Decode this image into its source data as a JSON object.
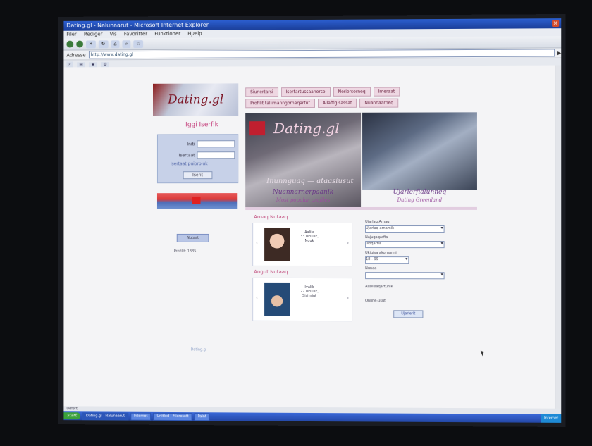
{
  "window": {
    "title": "Dating.gl - Nalunaarut - Microsoft Internet Explorer"
  },
  "address": {
    "value": "http://www.dating.gl"
  },
  "site": {
    "logo_text": "Dating.gl",
    "nav_row1": [
      "Siunertarsi",
      "Isertartussaanerso",
      "Neriorsorneq",
      "Imeraat"
    ],
    "nav_row2": [
      "Profilit tallimanngorneqartut",
      "Allaffigisassat",
      "Nuannaarneq"
    ],
    "login_title": "Iggi Iserfik",
    "login_user_label": "Initi",
    "login_pass_label": "Isertaat",
    "login_hint": "Isertaat puiorpiuk",
    "login_button": "Iserit",
    "hero1_logo": "Dating.gl",
    "hero1_sub": "Inunnguaq — ataasiusut",
    "cap1": "Nuannarnerpaanik",
    "cap1b": "Most popular profiles",
    "cap2": "Ujarlerfialunneq",
    "cap2b": "Dating Greenland",
    "section1": "Arnaq Nutaaq",
    "section2": "Angut Nutaaq",
    "profile1": {
      "name": "Aaliia",
      "info": "33 ukiulik, Nuuk"
    },
    "profile2": {
      "name": "Ivalik",
      "info": "27 ukiulik, Sisimiut"
    },
    "search": {
      "label1": "Ujarlaq Arnaq",
      "select1": "Ujarlaq arnamik",
      "label2": "Najugaqarfia",
      "select2": "Illoqarfia",
      "label3": "Ukiuisa akornanni",
      "select3": "18 - 99",
      "label4": "Nunaa",
      "select4": "",
      "label5": "Assilisaqartunik",
      "label6": "Online-usut",
      "button": "Ujarlerit"
    },
    "side_button": "Nutaat",
    "side_count": "Profilit: 1335",
    "footer": "Dating.gl"
  },
  "statusbar": {
    "text": "Udført"
  },
  "taskbar": {
    "start": "start",
    "tasks": [
      "Dating.gl - Nalunaarut",
      "Internet",
      "Unitled - Microsoft",
      "Paint"
    ],
    "tray": "Internet"
  }
}
